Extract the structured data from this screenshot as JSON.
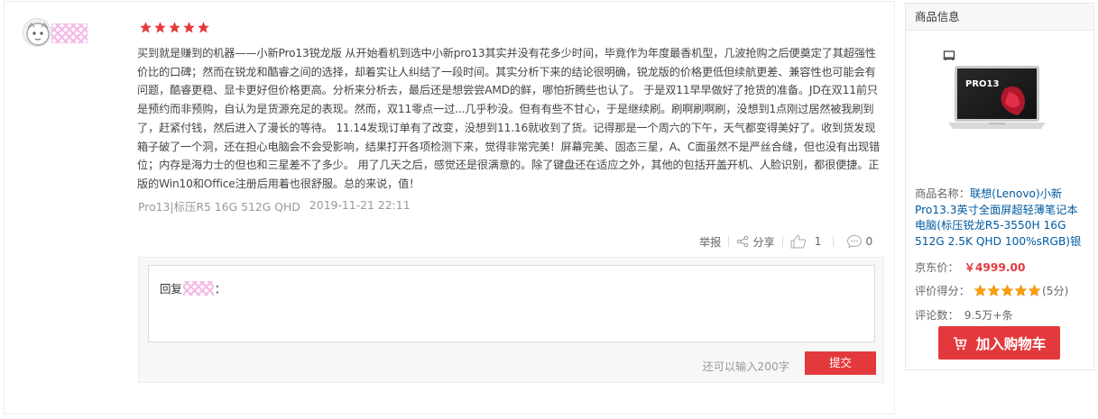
{
  "review": {
    "rating": 5,
    "text": "买到就是赚到的机器——小新Pro13锐龙版 从开始看机到选中小新pro13其实并没有花多少时间，毕竟作为年度最香机型，几波抢购之后便奠定了其超强性价比的口碑；然而在锐龙和酷睿之间的选择，却着实让人纠结了一段时间。其实分析下来的结论很明确，锐龙版的价格更低但续航更差、兼容性也可能会有问题，酷睿更稳、显卡更好但价格更高。分析来分析去，最后还是想尝尝AMD的鲜，哪怕折腾些也认了。 于是双11早早做好了抢货的准备。JD在双11前只是预约而非预购，自认为是货源充足的表现。然而，双11零点一过...几乎秒没。但有有些不甘心，于是继续刷。刷啊刷啊刷，没想到1点刚过居然被我刷到了，赶紧付钱，然后进入了漫长的等待。 11.14发现订单有了改变，没想到11.16就收到了货。记得那是一个周六的下午，天气都变得美好了。收到货发现箱子破了一个洞，还在担心电脑会不会受影响，结果打开各项检测下来，觉得非常完美！屏幕完美、固态三星，A、C面虽然不是严丝合缝，但也没有出现错位；内存是海力士的但也和三星差不了多少。 用了几天之后，感觉还是很满意的。除了键盘还在适应之外，其他的包括开盖开机、人脸识别，都很便捷。正版的Win10和Office注册后用着也很舒服。总的来说，值！",
    "spec": "Pro13|标压R5 16G 512G QHD",
    "date": "2019-11-21 22:11"
  },
  "actions": {
    "report_label": "举报",
    "share_label": "分享",
    "like_count": "1",
    "comment_count": "0"
  },
  "reply": {
    "prefix": "回复",
    "suffix": "：",
    "remaining_text": "还可以输入200字",
    "submit_label": "提交"
  },
  "product": {
    "header": "商品信息",
    "name_label": "商品名称：",
    "name": "联想(Lenovo)小新Pro13.3英寸全面屏超轻薄笔记本电脑(标压锐龙R5-3550H 16G 512G 2.5K QHD 100%sRGB)银",
    "price_label": "京东价：",
    "price": "￥4999.00",
    "score_label": "评价得分：",
    "score": "(5分)",
    "score_value": 5,
    "count_label": "评论数：",
    "count": "9.5万+条",
    "cart_label": "加入购物车",
    "screen_badge": "PRO13"
  },
  "colors": {
    "accent": "#e4393c",
    "link": "#005aa0",
    "star": "#e4393c",
    "star_small": "#ff9d00"
  }
}
